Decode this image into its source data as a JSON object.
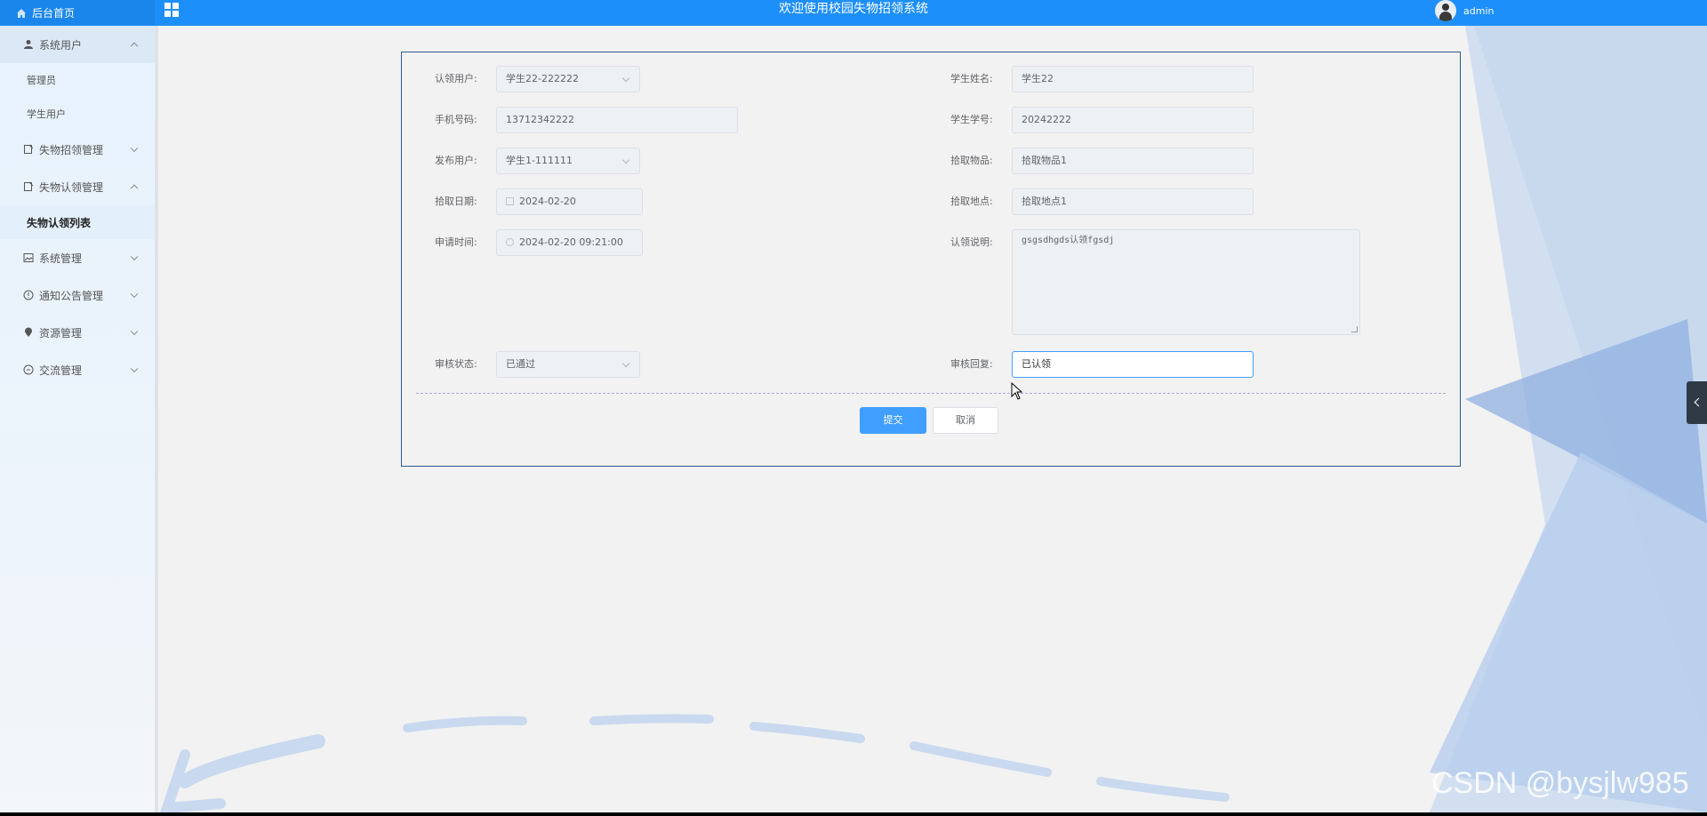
{
  "topbar": {
    "home_label": "后台首页",
    "title": "欢迎使用校园失物招领系统",
    "username": "admin"
  },
  "sidebar": {
    "items": [
      {
        "label": "系统用户",
        "icon": "user-icon",
        "expanded": true
      },
      {
        "label": "失物招领管理",
        "icon": "document-icon",
        "expanded": false
      },
      {
        "label": "失物认领管理",
        "icon": "document-icon",
        "expanded": true
      },
      {
        "label": "系统管理",
        "icon": "image-icon",
        "expanded": false
      },
      {
        "label": "通知公告管理",
        "icon": "info-circle-icon",
        "expanded": false
      },
      {
        "label": "资源管理",
        "icon": "location-icon",
        "expanded": false
      },
      {
        "label": "交流管理",
        "icon": "chat-icon",
        "expanded": false
      }
    ],
    "sub_items": {
      "admin": "管理员",
      "student_user": "学生用户",
      "claim_list": "失物认领列表"
    }
  },
  "form": {
    "claim_user": {
      "label": "认领用户:",
      "value": "学生22-222222"
    },
    "student_name": {
      "label": "学生姓名:",
      "value": "学生22"
    },
    "phone": {
      "label": "手机号码:",
      "value": "13712342222"
    },
    "student_no": {
      "label": "学生学号:",
      "value": "20242222"
    },
    "publish_user": {
      "label": "发布用户:",
      "value": "学生1-111111"
    },
    "item": {
      "label": "拾取物品:",
      "value": "拾取物品1"
    },
    "pick_date": {
      "label": "拾取日期:",
      "value": "2024-02-20"
    },
    "pick_place": {
      "label": "拾取地点:",
      "value": "拾取地点1"
    },
    "apply_time": {
      "label": "申请时间:",
      "value": "2024-02-20 09:21:00"
    },
    "claim_desc": {
      "label": "认领说明:",
      "value": "gsgsdhgds认领fgsdj"
    },
    "review_status": {
      "label": "审核状态:",
      "value": "已通过"
    },
    "review_reply": {
      "label": "审核回复:",
      "value": "已认领"
    },
    "submit_label": "提交",
    "cancel_label": "取消"
  },
  "watermark": "CSDN @bysjlw985",
  "colors": {
    "topbar": "#1d8ffb",
    "primary": "#409eff",
    "panel_border": "#2c5a8c"
  }
}
